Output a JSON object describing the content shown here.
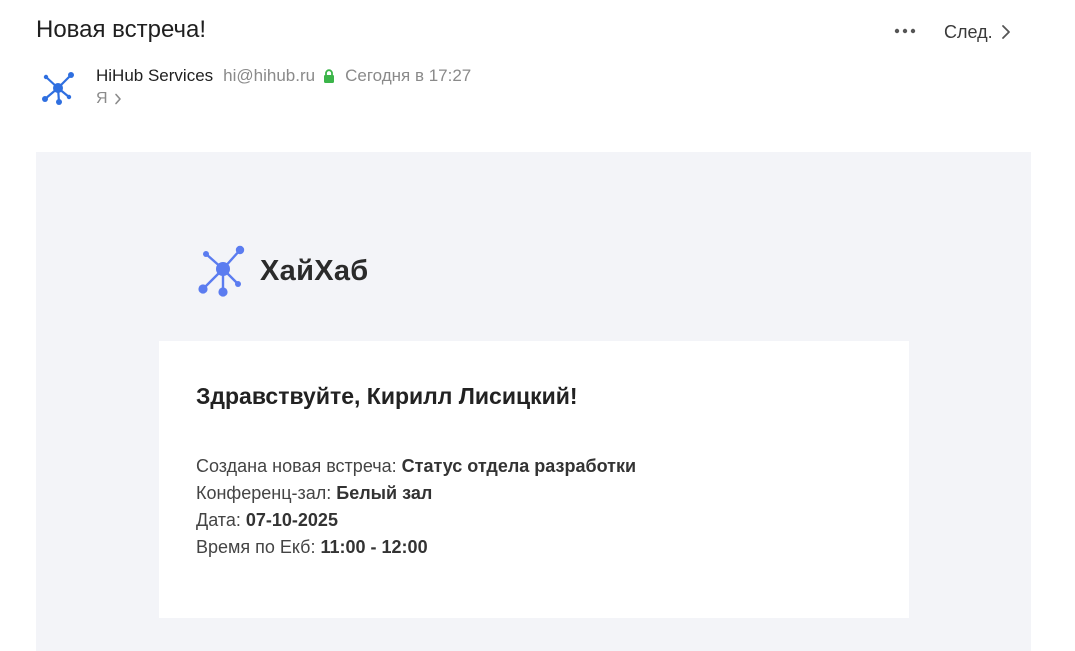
{
  "header": {
    "subject": "Новая встреча!",
    "next_label": "След.",
    "more_icon": "ellipsis-icon",
    "next_icon": "chevron-right-icon"
  },
  "sender": {
    "name": "HiHub Services",
    "email": "hi@hihub.ru",
    "time": "Сегодня в 17:27",
    "lock_icon": "lock-icon",
    "lock_color": "#3cb54a",
    "recipient": "Я"
  },
  "brand": {
    "name": "ХайХаб",
    "accent": "#5b7cf0"
  },
  "message": {
    "greeting": "Здравствуйте, Кирилл Лисицкий!",
    "meeting_label": "Создана новая встреча: ",
    "meeting_value": "Статус отдела разработки",
    "room_label": "Конференц-зал: ",
    "room_value": "Белый зал",
    "date_label": "Дата: ",
    "date_value": "07-10-2025",
    "time_label": "Время по Екб: ",
    "time_value": "11:00 - 12:00"
  },
  "colors": {
    "body_background": "#f3f4f8",
    "card_background": "#ffffff",
    "muted_text": "#8a8a8a"
  }
}
